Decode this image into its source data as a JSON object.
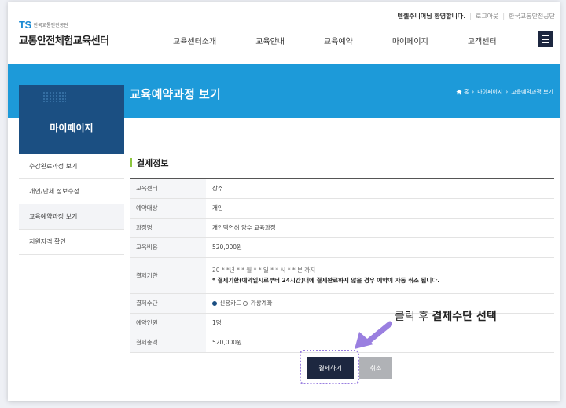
{
  "header": {
    "logo_ts": "TS",
    "logo_org": "한국교통안전공단",
    "logo_title": "교통안전체험교육센터",
    "util": {
      "welcome": "텐젤주니어님 환영합니다.",
      "logout": "로그아웃",
      "org_link": "한국교통안전공단"
    },
    "nav": [
      "교육센터소개",
      "교육안내",
      "교육예약",
      "마이페이지",
      "고객센터"
    ]
  },
  "banner": {
    "section": "마이페이지",
    "page_title": "교육예약과정 보기",
    "breadcrumb": [
      "홈",
      "마이페이지",
      "교육예약과정 보기"
    ]
  },
  "sidebar": {
    "items": [
      {
        "label": "수강완료과정 보기"
      },
      {
        "label": "개인/단체 정보수정"
      },
      {
        "label": "교육예약과정 보기",
        "active": true
      },
      {
        "label": "지원자격 확인"
      }
    ]
  },
  "payment": {
    "section_title": "결제정보",
    "rows": {
      "center": {
        "label": "교육센터",
        "value": "상주"
      },
      "target": {
        "label": "예약대상",
        "value": "개인"
      },
      "course": {
        "label": "과정명",
        "value": "개인택연허 양수 교육과정"
      },
      "fee": {
        "label": "교육비용",
        "value": "520,000원"
      },
      "deadline": {
        "label": "결제기한",
        "value": "20 * *년 * * 월 * * 일 * * 시 * * 분 까지",
        "note": "* 결제기한(예약일시로부터 24시간)내에 결제완료하지 않을 경우 예약이 자동 취소 됩니다."
      },
      "method": {
        "label": "결제수단",
        "opt1": "신용카드",
        "opt2": "가상계좌"
      },
      "people": {
        "label": "예약인원",
        "value": "1명"
      },
      "total": {
        "label": "결제총액",
        "value": "520,000원"
      }
    },
    "pay_button": "결제하기",
    "cancel_button": "취소"
  },
  "annotation": {
    "text_pre": "클릭 후 ",
    "text_bold": "결제수단 선택"
  },
  "colors": {
    "banner": "#1d9ad9",
    "sidebar_title": "#1b4f82",
    "primary_button": "#1d2740",
    "accent_green": "#8dc63f",
    "annotation": "#9a7fe0"
  }
}
